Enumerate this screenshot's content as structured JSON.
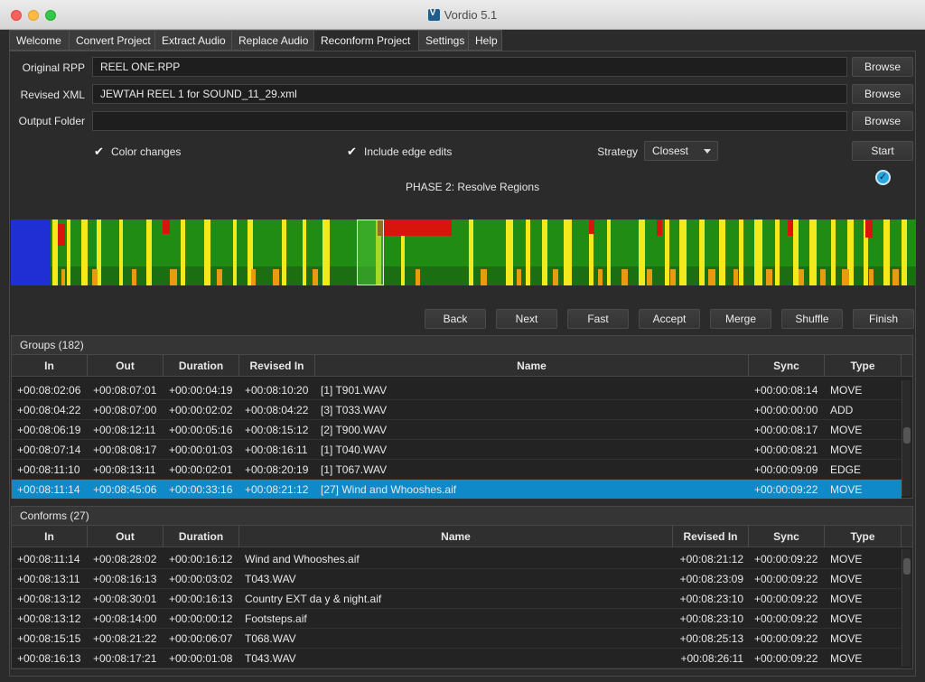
{
  "window": {
    "title": "Vordio 5.1"
  },
  "tabs": [
    "Welcome",
    "Convert Project",
    "Extract Audio",
    "Replace Audio",
    "Reconform Project",
    "Settings",
    "Help"
  ],
  "form": {
    "original_rpp_label": "Original RPP",
    "original_rpp_value": "REEL ONE.RPP",
    "revised_xml_label": "Revised XML",
    "revised_xml_value": "JEWTAH REEL 1 for SOUND_11_29.xml",
    "output_folder_label": "Output Folder",
    "output_folder_value": "",
    "browse_label": "Browse",
    "color_changes_label": "Color changes",
    "include_edge_label": "Include edge edits",
    "strategy_label": "Strategy",
    "strategy_value": "Closest",
    "start_label": "Start",
    "phase_text": "PHASE 2: Resolve Regions"
  },
  "nav_buttons": [
    "Back",
    "Next",
    "Fast",
    "Accept",
    "Merge",
    "Shuffle",
    "Finish"
  ],
  "groups": {
    "title": "Groups (182)",
    "columns": [
      "In",
      "Out",
      "Duration",
      "Revised In",
      "Name",
      "Sync",
      "Type"
    ],
    "rows": [
      [
        "+00:08:02:06",
        "+00:08:07:01",
        "+00:00:04:19",
        "+00:08:10:20",
        "[1] T901.WAV",
        "+00:00:08:14",
        "MOVE"
      ],
      [
        "+00:08:04:22",
        "+00:08:07:00",
        "+00:00:02:02",
        "+00:08:04:22",
        "[3] T033.WAV",
        "+00:00:00:00",
        "ADD"
      ],
      [
        "+00:08:06:19",
        "+00:08:12:11",
        "+00:00:05:16",
        "+00:08:15:12",
        "[2] T900.WAV",
        "+00:00:08:17",
        "MOVE"
      ],
      [
        "+00:08:07:14",
        "+00:08:08:17",
        "+00:00:01:03",
        "+00:08:16:11",
        "[1] T040.WAV",
        "+00:00:08:21",
        "MOVE"
      ],
      [
        "+00:08:11:10",
        "+00:08:13:11",
        "+00:00:02:01",
        "+00:08:20:19",
        "[1] T067.WAV",
        "+00:00:09:09",
        "EDGE"
      ],
      [
        "+00:08:11:14",
        "+00:08:45:06",
        "+00:00:33:16",
        "+00:08:21:12",
        "[27] Wind and Whooshes.aif",
        "+00:00:09:22",
        "MOVE"
      ]
    ],
    "selected_row": 5
  },
  "conforms": {
    "title": "Conforms (27)",
    "columns": [
      "In",
      "Out",
      "Duration",
      "Name",
      "Revised In",
      "Sync",
      "Type"
    ],
    "rows": [
      [
        "+00:08:11:14",
        "+00:08:28:02",
        "+00:00:16:12",
        "Wind and Whooshes.aif",
        "+00:08:21:12",
        "+00:00:09:22",
        "MOVE"
      ],
      [
        "+00:08:13:11",
        "+00:08:16:13",
        "+00:00:03:02",
        "T043.WAV",
        "+00:08:23:09",
        "+00:00:09:22",
        "MOVE"
      ],
      [
        "+00:08:13:12",
        "+00:08:30:01",
        "+00:00:16:13",
        "Country EXT da y & night.aif",
        "+00:08:23:10",
        "+00:00:09:22",
        "MOVE"
      ],
      [
        "+00:08:13:12",
        "+00:08:14:00",
        "+00:00:00:12",
        "Footsteps.aif",
        "+00:08:23:10",
        "+00:00:09:22",
        "MOVE"
      ],
      [
        "+00:08:15:15",
        "+00:08:21:22",
        "+00:00:06:07",
        "T068.WAV",
        "+00:08:25:13",
        "+00:00:09:22",
        "MOVE"
      ],
      [
        "+00:08:16:13",
        "+00:08:17:21",
        "+00:00:01:08",
        "T043.WAV",
        "+00:08:26:11",
        "+00:00:09:22",
        "MOVE"
      ]
    ]
  },
  "colors": {
    "selection": "#0f89c8",
    "timeline_green": "#218c14",
    "timeline_yellow": "#f2ea1c",
    "timeline_red": "#d8150c",
    "timeline_blue": "#1f2fd4",
    "timeline_orange": "#e99a11"
  }
}
